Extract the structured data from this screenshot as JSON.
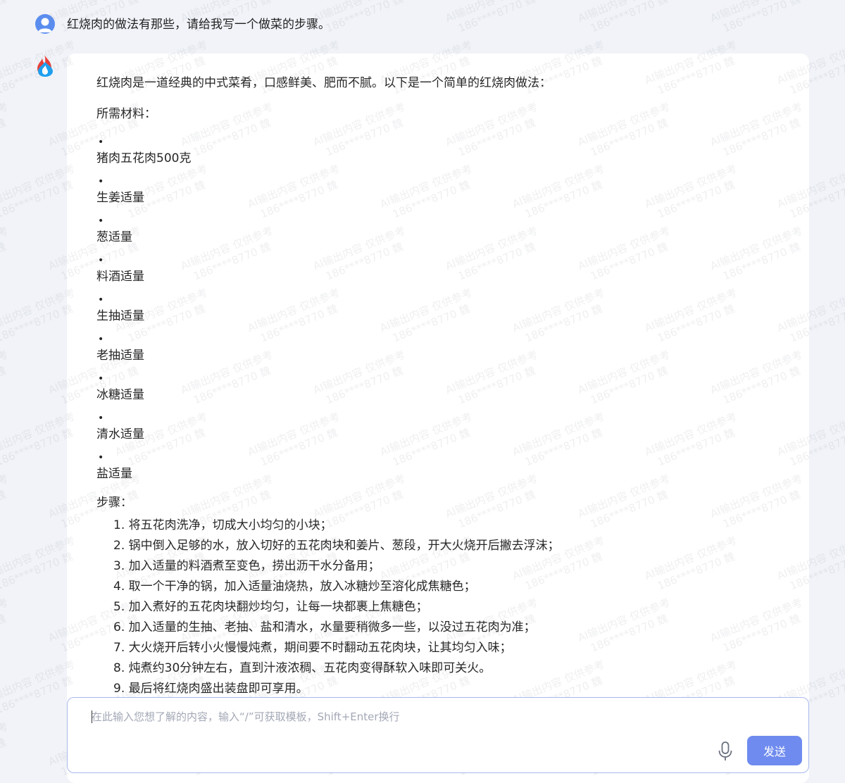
{
  "conversation": {
    "user_message": "红烧肉的做法有那些，请给我写一个做菜的步骤。",
    "answer": {
      "intro": "红烧肉是一道经典的中式菜肴，口感鲜美、肥而不腻。以下是一个简单的红烧肉做法：",
      "ingredients_title": "所需材料：",
      "bullet": "•",
      "ingredients": [
        "猪肉五花肉500克",
        "生姜适量",
        "葱适量",
        "料酒适量",
        "生抽适量",
        "老抽适量",
        "冰糖适量",
        "清水适量",
        "盐适量"
      ],
      "steps_title": "步骤：",
      "steps": [
        "1. 将五花肉洗净，切成大小均匀的小块；",
        "2. 锅中倒入足够的水，放入切好的五花肉块和姜片、葱段，开大火烧开后撇去浮沫；",
        "3. 加入适量的料酒煮至变色，捞出沥干水分备用；",
        "4. 取一个干净的锅，加入适量油烧热，放入冰糖炒至溶化成焦糖色；",
        "5. 加入煮好的五花肉块翻炒均匀，让每一块都裹上焦糖色；",
        "6. 加入适量的生抽、老抽、盐和清水，水量要稍微多一些，以没过五花肉为准；",
        "7. 大火烧开后转小火慢慢炖煮，期间要不时翻动五花肉块，让其均匀入味；",
        "8. 炖煮约30分钟左右，直到汁液浓稠、五花肉变得酥软入味即可关火。",
        "9. 最后将红烧肉盛出装盘即可享用。"
      ]
    }
  },
  "input": {
    "placeholder": "在此输入您想了解的内容，输入“/”可获取模板，Shift+Enter换行",
    "send_label": "发送"
  },
  "icons": {
    "user_avatar": "user-avatar-icon",
    "bot_avatar": "flame-drop-logo-icon",
    "mic": "microphone-icon"
  },
  "watermark": {
    "line1": "AI输出内容 仅供参考",
    "line2": "186****8770 魏"
  },
  "colors": {
    "background": "#f1f3f8",
    "accent": "#6f8bef",
    "user_avatar": "#5b8def",
    "logo_red": "#e8413a",
    "logo_blue": "#1ea0f0"
  }
}
